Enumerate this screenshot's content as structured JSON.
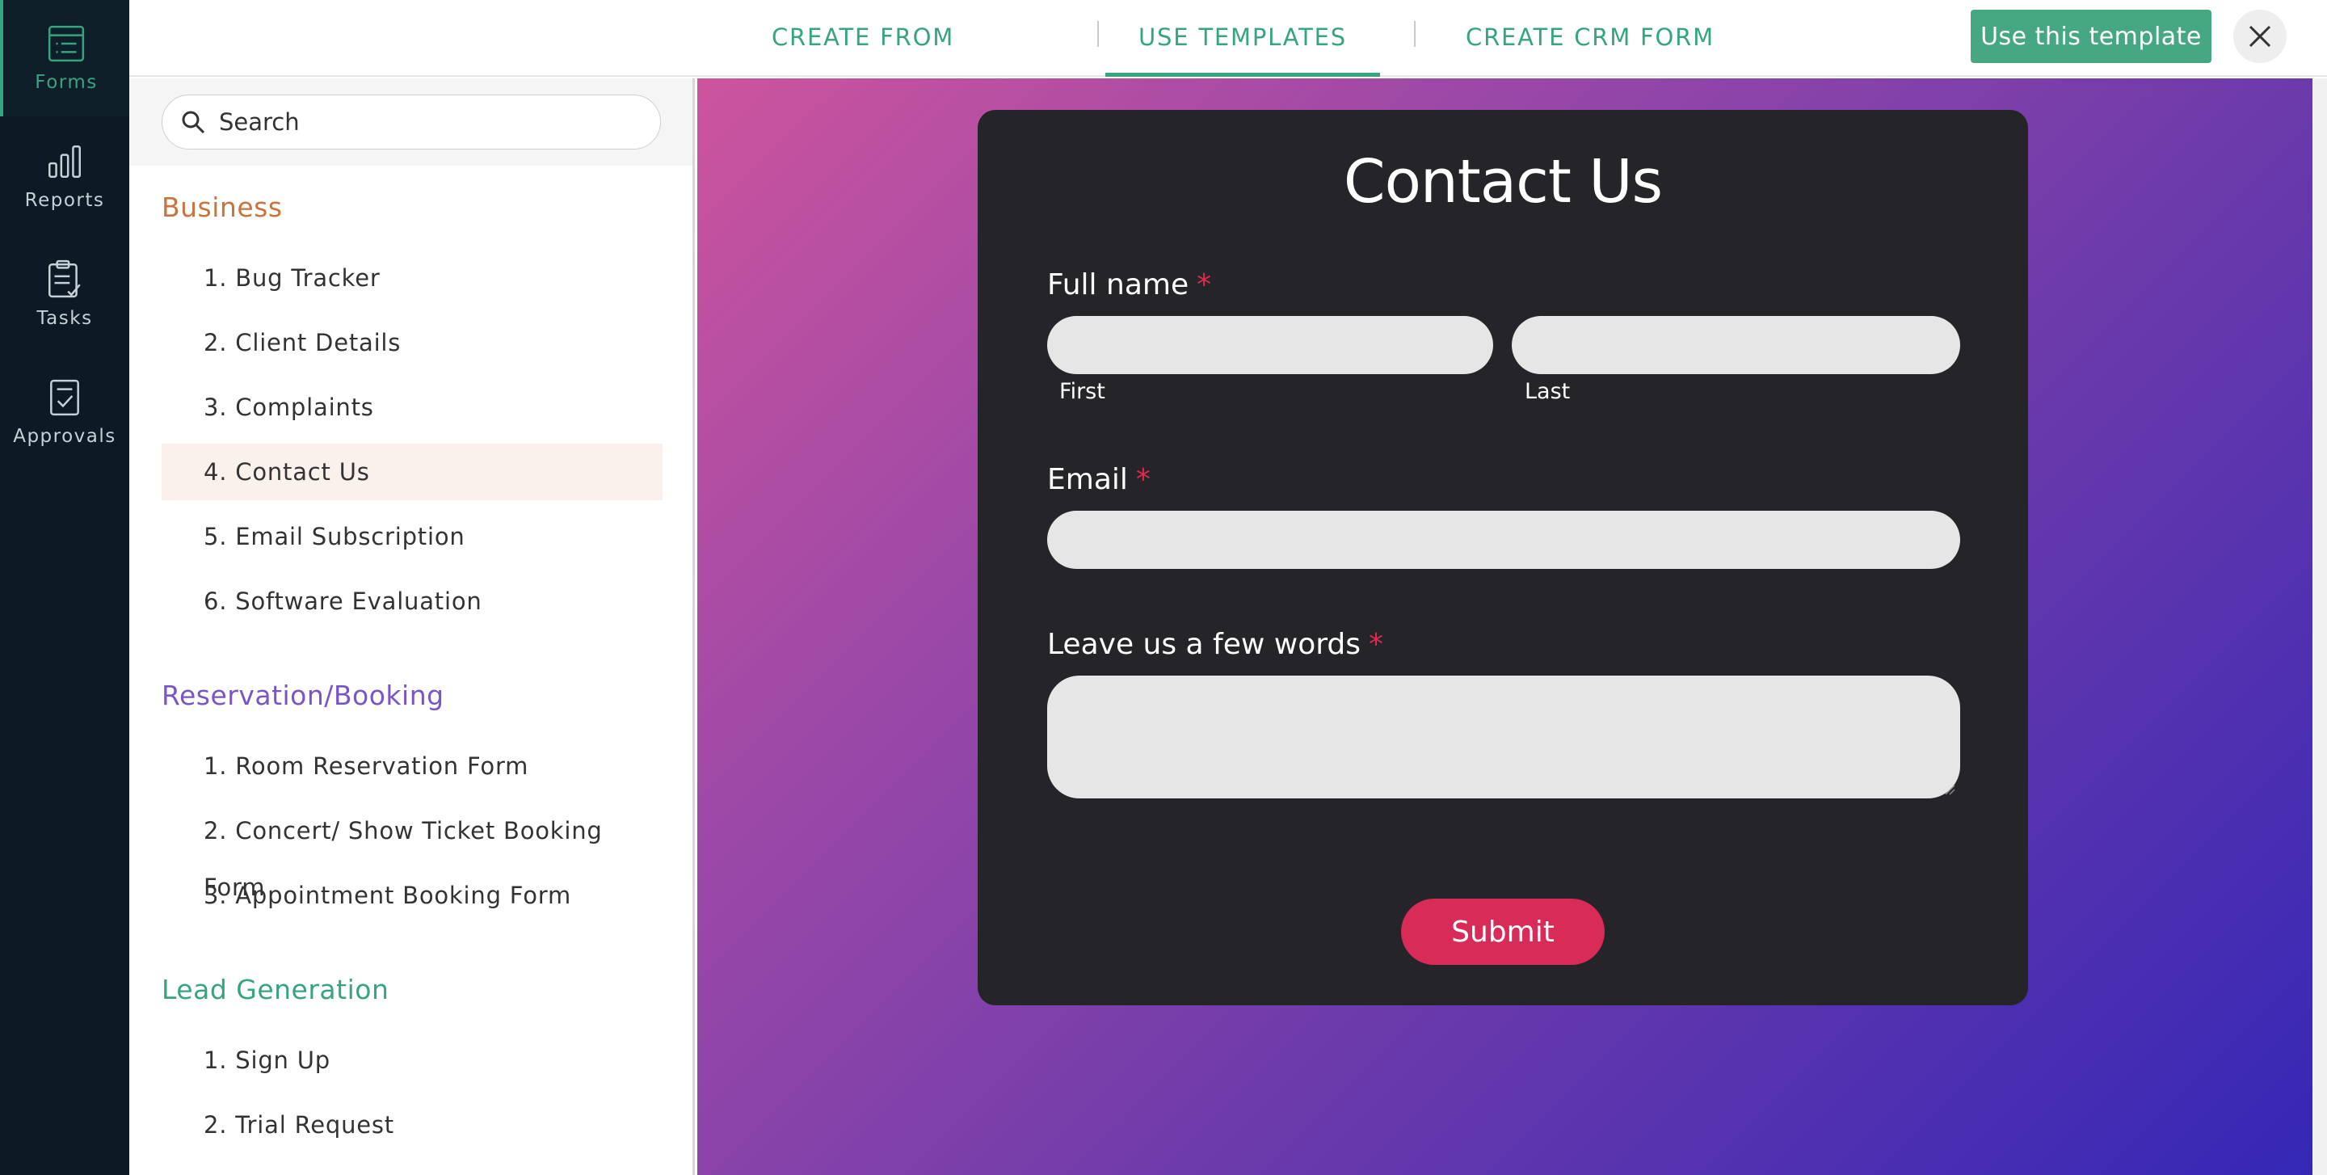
{
  "rail": {
    "items": [
      {
        "label": "Forms",
        "icon": "forms-icon",
        "active": true
      },
      {
        "label": "Reports",
        "icon": "reports-icon"
      },
      {
        "label": "Tasks",
        "icon": "tasks-icon"
      },
      {
        "label": "Approvals",
        "icon": "approvals-icon"
      }
    ]
  },
  "topbar": {
    "tabs": [
      {
        "label": "CREATE FROM SCRATCH"
      },
      {
        "label": "USE TEMPLATES",
        "active": true
      },
      {
        "label": "CREATE CRM FORM"
      }
    ],
    "use_template_label": "Use this template",
    "accent_color": "#36a57f"
  },
  "sidebar": {
    "search_placeholder": "Search",
    "categories": [
      {
        "name": "Business",
        "color": "#c9733f",
        "items": [
          "1. Bug Tracker",
          "2. Client Details",
          "3. Complaints",
          "4. Contact Us",
          "5. Email Subscription",
          "6. Software Evaluation"
        ]
      },
      {
        "name": "Reservation/Booking",
        "color": "#7a55c8",
        "items": [
          "1. Room Reservation Form",
          "2. Concert/ Show Ticket Booking Form",
          "3. Appointment Booking Form"
        ]
      },
      {
        "name": "Lead Generation",
        "color": "#36a57f",
        "items": [
          "1. Sign Up",
          "2. Trial Request"
        ]
      }
    ],
    "selected_item": "4. Contact Us"
  },
  "form_preview": {
    "title": "Contact Us",
    "required_marker": "*",
    "full_name_label": "Full name",
    "first_sublabel": "First",
    "last_sublabel": "Last",
    "email_label": "Email",
    "message_label": "Leave us a few words",
    "submit_label": "Submit",
    "submit_color": "#d92b58"
  }
}
